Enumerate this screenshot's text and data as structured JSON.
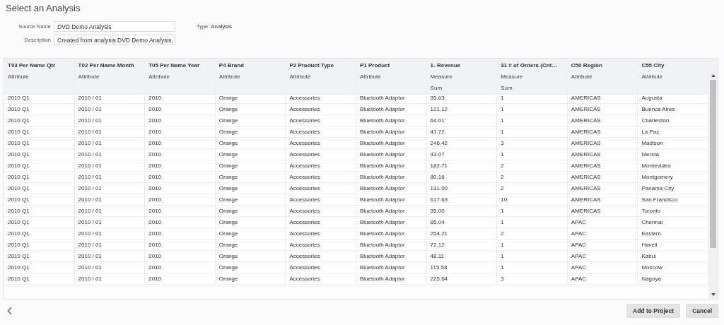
{
  "title": "Select an Analysis",
  "form": {
    "source_name": {
      "label": "Source Name",
      "value": "DVD Demo Analysis"
    },
    "description": {
      "label": "Description",
      "value": "Created from analysis DVD Demo Analysis."
    },
    "type": {
      "label": "Type",
      "value": "Analysis"
    }
  },
  "table": {
    "columns": [
      {
        "name": "T03 Per Name Qtr",
        "role": "Attribute"
      },
      {
        "name": "T02 Per Name Month",
        "role": "Attribute"
      },
      {
        "name": "T05 Per Name Year",
        "role": "Attribute"
      },
      {
        "name": "P4 Brand",
        "role": "Attribute"
      },
      {
        "name": "P2 Product Type",
        "role": "Attribute"
      },
      {
        "name": "P1 Product",
        "role": "Attribute"
      },
      {
        "name": "1- Revenue",
        "role": "Measure",
        "aggregation": "Sum"
      },
      {
        "name": "31 # of Orders (Cnt…",
        "role": "Measure",
        "aggregation": "Sum"
      },
      {
        "name": "C50 Region",
        "role": "Attribute"
      },
      {
        "name": "C55 City",
        "role": "Attribute"
      }
    ],
    "rows": [
      [
        "2010 Q1",
        "2010 / 01",
        "2010",
        "Orange",
        "Accessories",
        "Bluetooth Adaptor",
        "35.63",
        "1",
        "AMERICAS",
        "Augusta"
      ],
      [
        "2010 Q1",
        "2010 / 01",
        "2010",
        "Orange",
        "Accessories",
        "Bluetooth Adaptor",
        "121.12",
        "1",
        "AMERICAS",
        "Buenos Aires"
      ],
      [
        "2010 Q1",
        "2010 / 01",
        "2010",
        "Orange",
        "Accessories",
        "Bluetooth Adaptor",
        "64.01",
        "1",
        "AMERICAS",
        "Charleston"
      ],
      [
        "2010 Q1",
        "2010 / 01",
        "2010",
        "Orange",
        "Accessories",
        "Bluetooth Adaptor",
        "41.72",
        "1",
        "AMERICAS",
        "La Paz"
      ],
      [
        "2010 Q1",
        "2010 / 01",
        "2010",
        "Orange",
        "Accessories",
        "Bluetooth Adaptor",
        "246.42",
        "3",
        "AMERICAS",
        "Madison"
      ],
      [
        "2010 Q1",
        "2010 / 01",
        "2010",
        "Orange",
        "Accessories",
        "Bluetooth Adaptor",
        "43.07",
        "1",
        "AMERICAS",
        "Merida"
      ],
      [
        "2010 Q1",
        "2010 / 01",
        "2010",
        "Orange",
        "Accessories",
        "Bluetooth Adaptor",
        "182.71",
        "2",
        "AMERICAS",
        "Montevideo"
      ],
      [
        "2010 Q1",
        "2010 / 01",
        "2010",
        "Orange",
        "Accessories",
        "Bluetooth Adaptor",
        "80.16",
        "2",
        "AMERICAS",
        "Montgomery"
      ],
      [
        "2010 Q1",
        "2010 / 01",
        "2010",
        "Orange",
        "Accessories",
        "Bluetooth Adaptor",
        "131.00",
        "2",
        "AMERICAS",
        "Panama City"
      ],
      [
        "2010 Q1",
        "2010 / 01",
        "2010",
        "Orange",
        "Accessories",
        "Bluetooth Adaptor",
        "617.63",
        "10",
        "AMERICAS",
        "San Francisco"
      ],
      [
        "2010 Q1",
        "2010 / 01",
        "2010",
        "Orange",
        "Accessories",
        "Bluetooth Adaptor",
        "35.00",
        "1",
        "AMERICAS",
        "Toronto"
      ],
      [
        "2010 Q1",
        "2010 / 01",
        "2010",
        "Orange",
        "Accessories",
        "Bluetooth Adaptor",
        "85.04",
        "1",
        "APAC",
        "Chennai"
      ],
      [
        "2010 Q1",
        "2010 / 01",
        "2010",
        "Orange",
        "Accessories",
        "Bluetooth Adaptor",
        "254.21",
        "2",
        "APAC",
        "Eastern"
      ],
      [
        "2010 Q1",
        "2010 / 01",
        "2010",
        "Orange",
        "Accessories",
        "Bluetooth Adaptor",
        "72.12",
        "1",
        "APAC",
        "Haveli"
      ],
      [
        "2010 Q1",
        "2010 / 01",
        "2010",
        "Orange",
        "Accessories",
        "Bluetooth Adaptor",
        "48.11",
        "1",
        "APAC",
        "Kabul"
      ],
      [
        "2010 Q1",
        "2010 / 01",
        "2010",
        "Orange",
        "Accessories",
        "Bluetooth Adaptor",
        "115.58",
        "1",
        "APAC",
        "Moscow"
      ],
      [
        "2010 Q1",
        "2010 / 01",
        "2010",
        "Orange",
        "Accessories",
        "Bluetooth Adaptor",
        "225.64",
        "3",
        "APAC",
        "Nagoya"
      ]
    ]
  },
  "buttons": [
    "Add to Project",
    "Cancel"
  ]
}
